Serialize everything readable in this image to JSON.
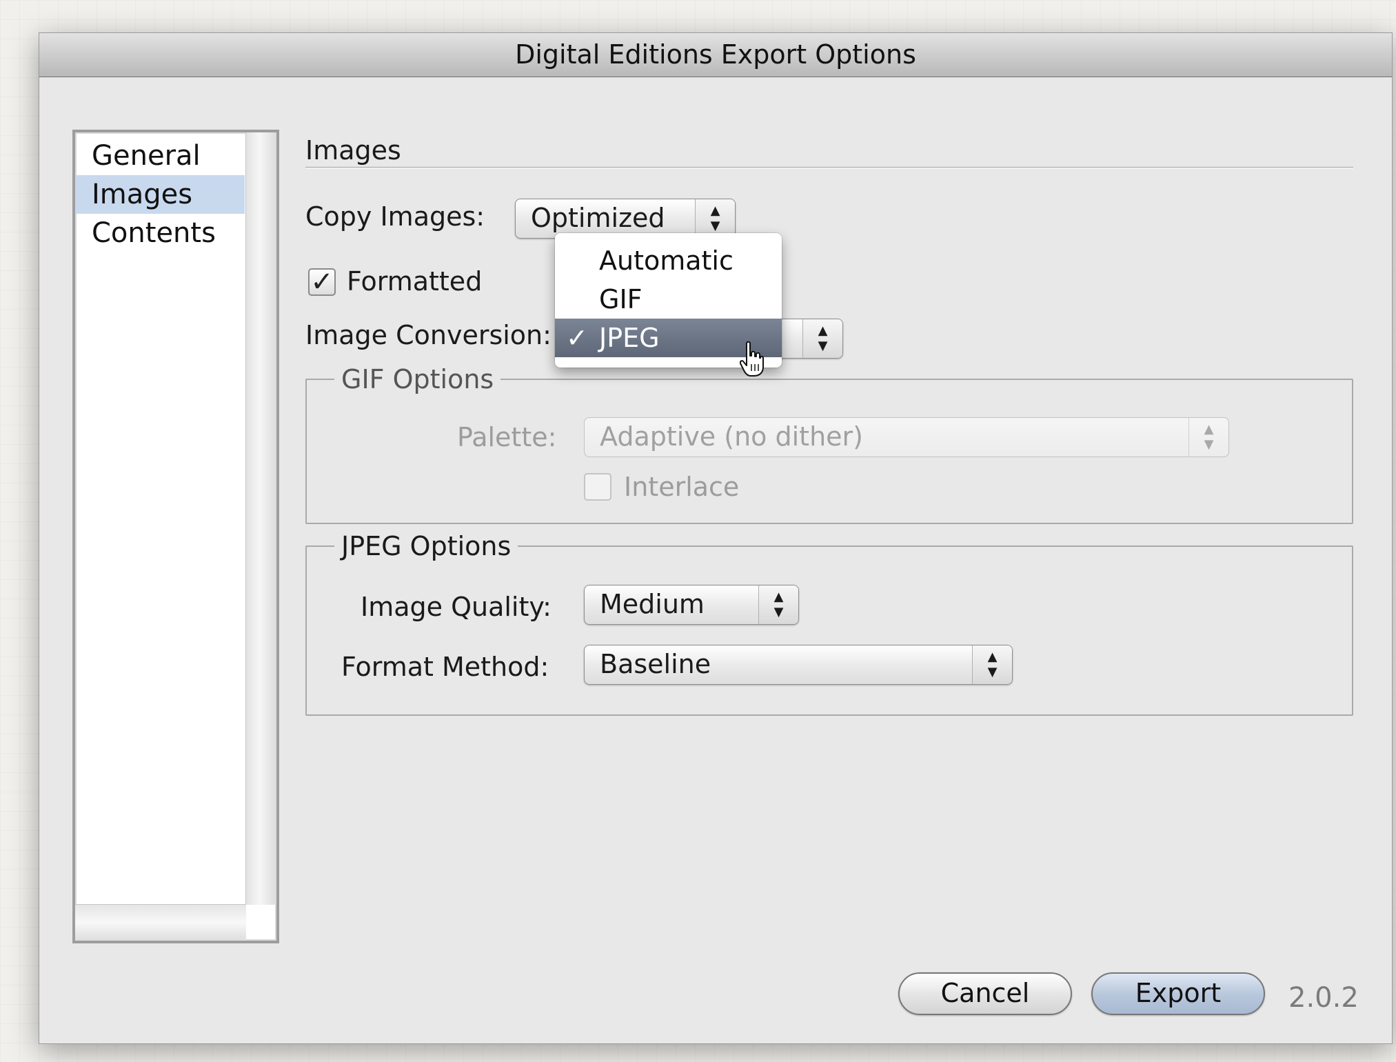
{
  "window": {
    "title": "Digital Editions Export Options"
  },
  "sidebar": {
    "items": [
      {
        "label": "General"
      },
      {
        "label": "Images"
      },
      {
        "label": "Contents"
      }
    ],
    "selected": "Images"
  },
  "section": {
    "title": "Images"
  },
  "copy_images": {
    "label": "Copy Images:",
    "value": "Optimized"
  },
  "formatted": {
    "label": "Formatted",
    "checked": true,
    "check_glyph": "✓"
  },
  "image_conversion": {
    "label": "Image Conversion:",
    "menu_open": true,
    "options": [
      {
        "label": "Automatic"
      },
      {
        "label": "GIF"
      },
      {
        "label": "JPEG",
        "selected": true
      }
    ],
    "check_glyph": "✓"
  },
  "gif_options": {
    "legend": "GIF Options",
    "palette_label": "Palette:",
    "palette_value": "Adaptive (no dither)",
    "interlace_label": "Interlace",
    "interlace_checked": false,
    "enabled": false
  },
  "jpeg_options": {
    "legend": "JPEG Options",
    "quality_label": "Image Quality:",
    "quality_value": "Medium",
    "format_label": "Format Method:",
    "format_value": "Baseline"
  },
  "buttons": {
    "cancel": "Cancel",
    "export": "Export"
  },
  "version": "2.0.2",
  "icons": {
    "popup_arrows": "▲▼",
    "cursor": "pointing-hand-cursor-icon"
  }
}
